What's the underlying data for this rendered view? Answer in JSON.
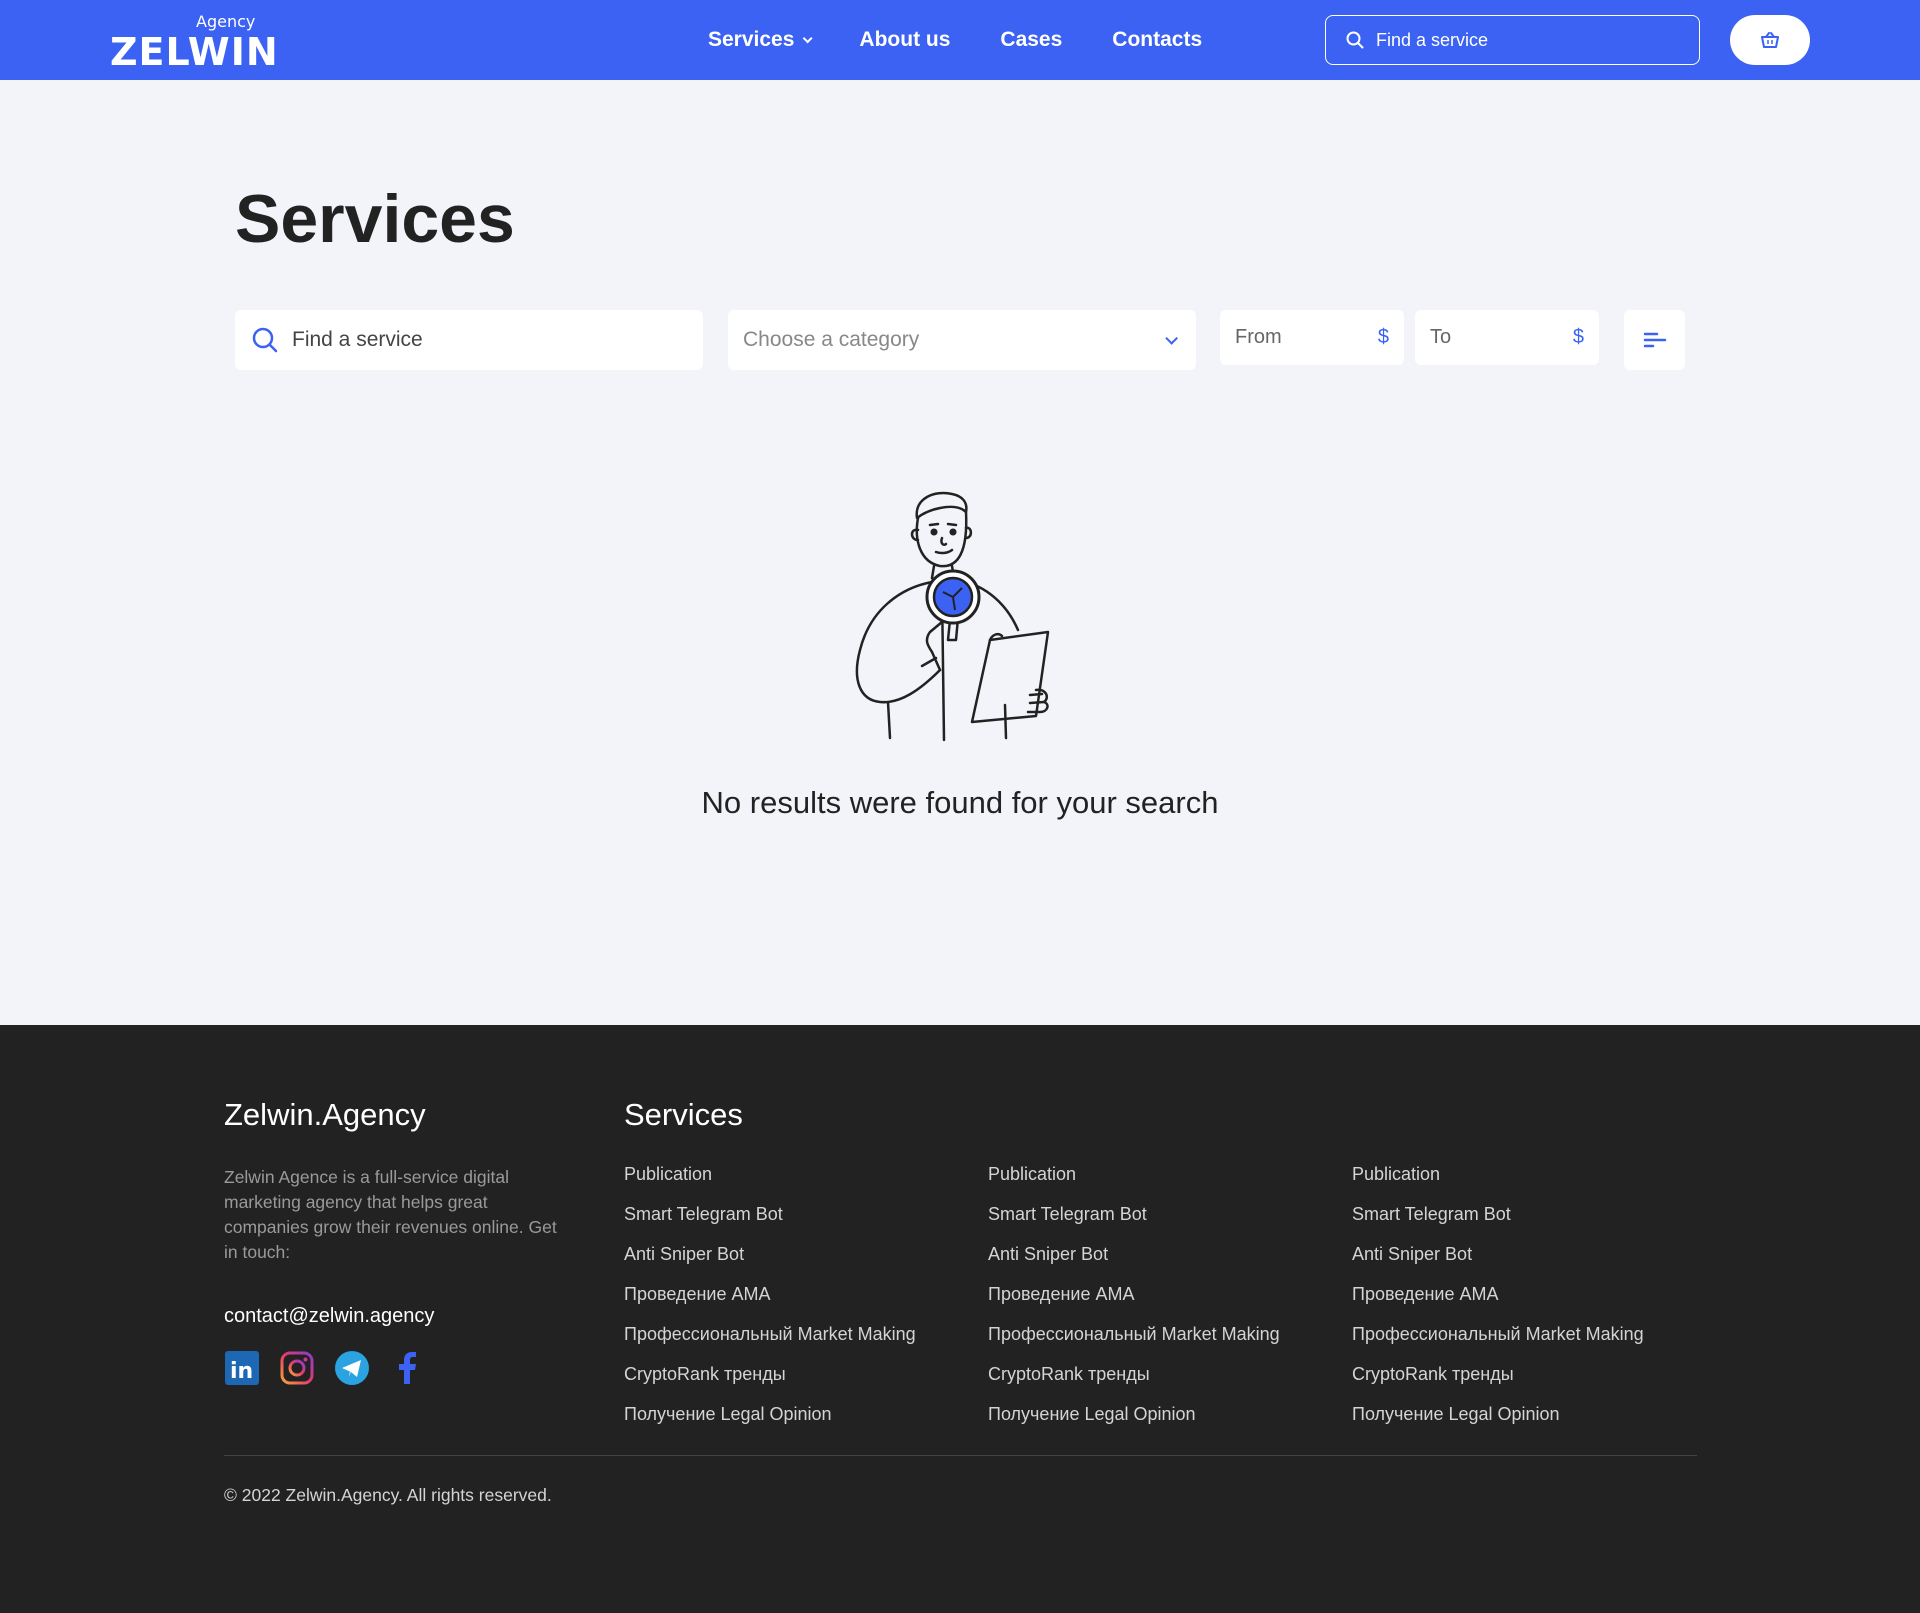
{
  "header": {
    "logo_small": "Agency",
    "logo_big": "ZELWIN",
    "nav": [
      "Services",
      "About us",
      "Cases",
      "Contacts"
    ],
    "search_placeholder": "Find a service"
  },
  "main": {
    "title": "Services",
    "search_placeholder": "Find a service",
    "category_placeholder": "Choose a category",
    "from_label": "From",
    "to_label": "To",
    "currency": "$",
    "no_results": "No results were found for your search"
  },
  "footer": {
    "brand": "Zelwin.Agency",
    "description": "Zelwin Agence is a full-service digital marketing agency that helps great companies grow their revenues online. Get in touch:",
    "email": "contact@zelwin.agency",
    "services_title": "Services",
    "columns": [
      [
        "Publication",
        "Smart Telegram Bot",
        "Anti Sniper Bot",
        "Проведение AMA",
        "Профессиональный Market Making",
        "CryptoRank тренды",
        "Получение Legal Opinion"
      ],
      [
        "Publication",
        "Smart Telegram Bot",
        "Anti Sniper Bot",
        "Проведение AMA",
        "Профессиональный Market Making",
        "CryptoRank тренды",
        "Получение Legal Opinion"
      ],
      [
        "Publication",
        "Smart Telegram Bot",
        "Anti Sniper Bot",
        "Проведение AMA",
        "Профессиональный Market Making",
        "CryptoRank тренды",
        "Получение Legal Opinion"
      ]
    ],
    "copyright": "© 2022 Zelwin.Agency. All rights reserved."
  },
  "colors": {
    "accent": "#3b62f2",
    "footer_bg": "#222222",
    "page_bg": "#f2f4f9"
  },
  "icons": [
    "search-icon",
    "cart-icon",
    "chevron-down-icon",
    "sort-icon",
    "linkedin-icon",
    "instagram-icon",
    "telegram-icon",
    "facebook-icon"
  ]
}
